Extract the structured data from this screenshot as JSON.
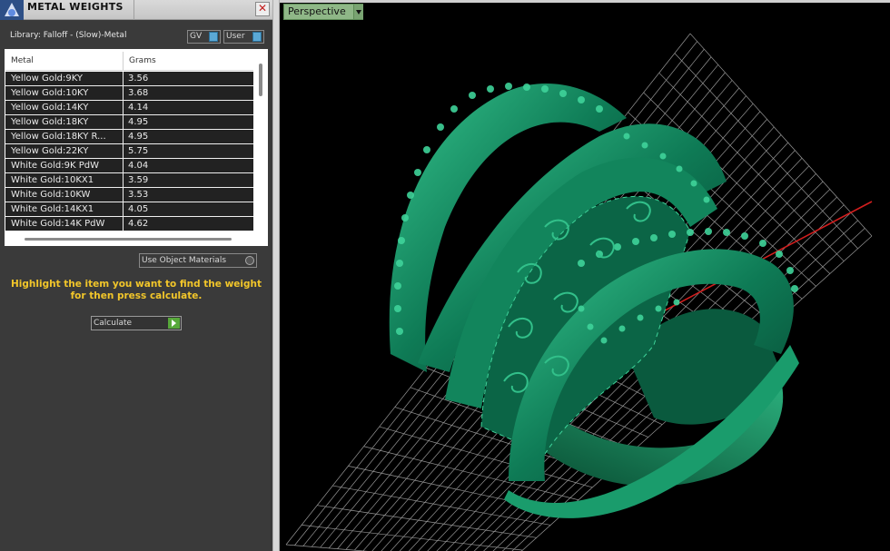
{
  "window": {
    "title": "METAL WEIGHTS",
    "close_glyph": "✕"
  },
  "library_label": "Library: Falloff - (Slow)-Metal",
  "toggles": {
    "gv": "GV",
    "user": "User"
  },
  "table": {
    "columns": [
      "Metal",
      "Grams"
    ],
    "rows": [
      [
        "Yellow Gold:9KY",
        "3.56"
      ],
      [
        "Yellow Gold:10KY",
        "3.68"
      ],
      [
        "Yellow Gold:14KY",
        "4.14"
      ],
      [
        "Yellow Gold:18KY",
        "4.95"
      ],
      [
        "Yellow Gold:18KY R...",
        "4.95"
      ],
      [
        "Yellow Gold:22KY",
        "5.75"
      ],
      [
        "White Gold:9K PdW",
        "4.04"
      ],
      [
        "White Gold:10KX1",
        "3.59"
      ],
      [
        "White Gold:10KW",
        "3.53"
      ],
      [
        "White Gold:14KX1",
        "4.05"
      ],
      [
        "White Gold:14K PdW",
        "4.62"
      ]
    ]
  },
  "use_object_materials": "Use Object Materials",
  "hint": "Highlight the item you want to find the weight for then press calculate.",
  "calculate_label": "Calculate",
  "viewport": {
    "label": "Perspective"
  },
  "colors": {
    "model": "#0f7a55",
    "highlight": "#3fd39a",
    "grid": "#c8c8c8",
    "axis": "#d21e1e"
  },
  "icons": [
    "app-logo-icon",
    "close-icon",
    "toggle-icon",
    "radio-icon",
    "play-arrow-icon",
    "chevron-down-icon"
  ]
}
